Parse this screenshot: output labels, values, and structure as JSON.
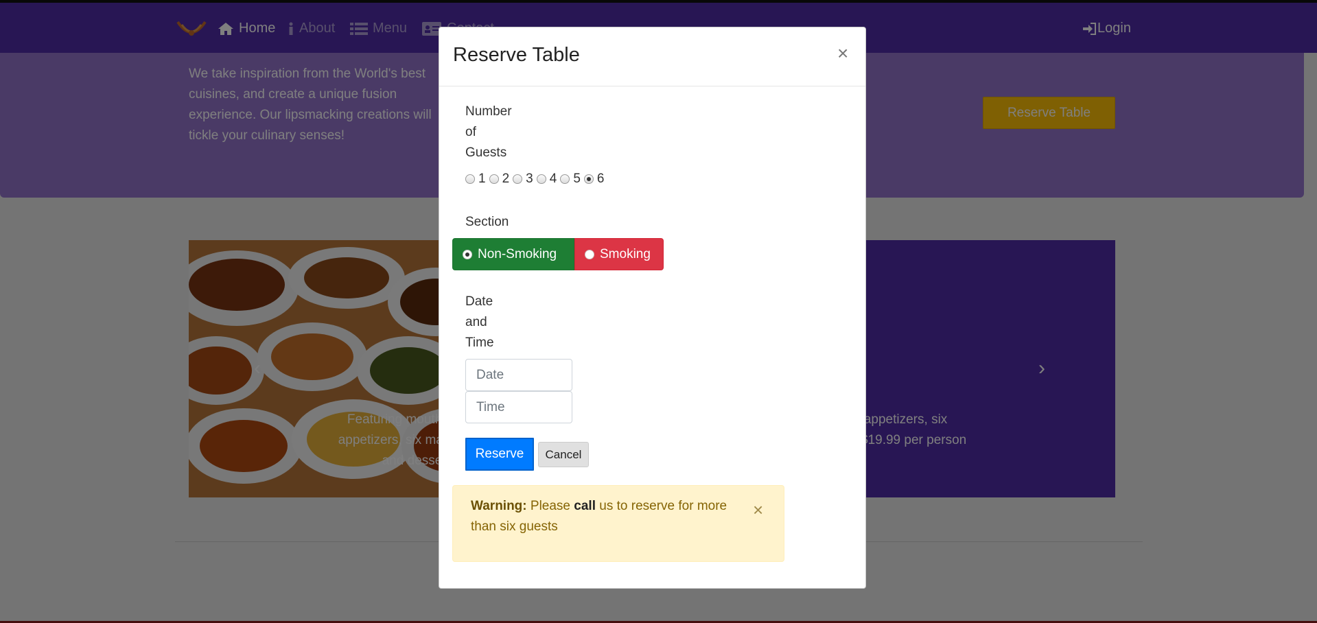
{
  "nav": {
    "home": "Home",
    "about": "About",
    "menu": "Menu",
    "contact": "Contact",
    "login": "Login"
  },
  "jumbotron": {
    "text": "We take inspiration from the World's best cuisines, and create a unique fusion experience. Our lipsmacking creations will tickle your culinary senses!",
    "button": "Reserve Table"
  },
  "carousel": {
    "caption_left": "Featuring mouthwatering appetizers, six main entrees and desserts",
    "caption_right_1": "g appetizers, six",
    "caption_right_2": "$19.99 per person"
  },
  "modal": {
    "title": "Reserve Table",
    "close": "×",
    "guests_label_1": "Number",
    "guests_label_2": "of",
    "guests_label_3": "Guests",
    "guest_options": [
      "1",
      "2",
      "3",
      "4",
      "5",
      "6"
    ],
    "guest_selected": "6",
    "section_label": "Section",
    "section_options": [
      "Non-Smoking",
      "Smoking"
    ],
    "section_selected": "Non-Smoking",
    "datetime_label_1": "Date",
    "datetime_label_2": "and",
    "datetime_label_3": "Time",
    "date_placeholder": "Date",
    "time_placeholder": "Time",
    "reserve_button": "Reserve",
    "cancel_button": "Cancel"
  },
  "alert": {
    "strong": "Warning:",
    "pre": "Please",
    "call": "call",
    "post": "us to reserve for more than six guests",
    "close": "×"
  },
  "colors": {
    "primary_purple": "#512da8",
    "light_purple": "#9575cd",
    "warning_yellow": "#ffc107",
    "non_smoking_green": "#1e7e34",
    "smoking_red": "#dc3545",
    "reserve_blue": "#007bff",
    "alert_bg": "#fff3cd"
  }
}
